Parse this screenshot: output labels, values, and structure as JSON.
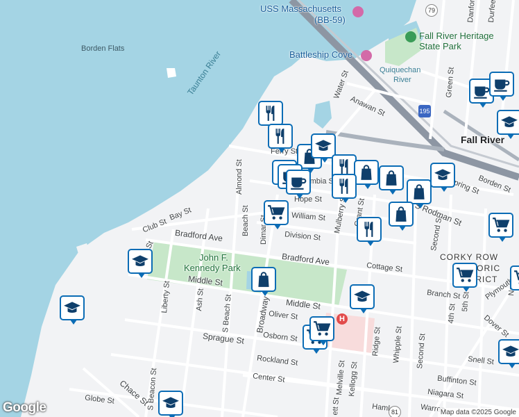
{
  "map": {
    "labels": {
      "uss_massachusetts": "USS Massachusetts",
      "bb59": "(BB-59)",
      "fall_river_heritage": "Fall River Heritage",
      "state_park": "State Park",
      "battleship_cove": "Battleship Cove",
      "quiquechan": "Quiquechan",
      "river": "River",
      "borden_flats": "Borden Flats",
      "taunton_river": "Taunton River",
      "fall_river": "Fall River",
      "jfk_park_1": "John F.",
      "jfk_park_2": "Kennedy Park",
      "corky_row_1": "CORKY ROW",
      "corky_row_2": "HISTORIC",
      "corky_row_3": "DISTRICT"
    },
    "streets": {
      "water_st": "Water St",
      "anawan_st": "Anawan St",
      "almond_st": "Almond St",
      "ferry_st": "Ferry St",
      "columbia_st": "Columbia St",
      "hope_st": "Hope St",
      "william_st": "William St",
      "bay_st": "Bay St",
      "club_st": "Club St",
      "beach_st": "Beach St",
      "dimar_st": "Dimar St",
      "mulberry_st": "Mulberry St",
      "grant_st": "Grant St",
      "division_st": "Division St",
      "bradford_ave": "Bradford Ave",
      "bradford_ave_2": "Bradford Ave",
      "bay_st_2": "Bay St",
      "liberty_st": "Liberty St",
      "ash_st": "Ash St",
      "s_beach_st": "S Beach St",
      "broadway": "Broadway",
      "middle_st": "Middle St",
      "middle_st_2": "Middle St",
      "oliver_st": "Oliver St",
      "osborn_st": "Osborn St",
      "sprague_st": "Sprague St",
      "rockland_st": "Rockland St",
      "center_st": "Center St",
      "s_beacon_st": "S Beacon St",
      "chace_st": "Chace St",
      "globe_st": "Globe St",
      "melville_st": "Melville St",
      "kellogg_st": "Kellogg St",
      "ridge_st": "Ridge St",
      "whipple_st": "Whipple St",
      "second_st": "Second St",
      "second_st_2": "Second St",
      "cottage_st": "Cottage St",
      "branch_st": "Branch St",
      "fourth_st": "4th St",
      "fifth_st": "5th St",
      "s_rodman_st": "S Rodman St",
      "spring_st": "Spring St",
      "borden_st": "Borden St",
      "green_st": "Green St",
      "durfee_st": "Durfee",
      "danforth_st": "Danforth",
      "plymouth_ave": "Plymouth",
      "dover_st": "Dover St",
      "snell_st": "Snell St",
      "buffinton_st": "Buffinton St",
      "niagara_st": "Niagara St",
      "warren_st": "Warren",
      "hamlet_st": "Hamlet",
      "ett_st": "ett St",
      "nash_st": "Nash"
    },
    "routes": {
      "i195": "195",
      "r79": "79",
      "r81": "81"
    },
    "hospital_symbol": "H",
    "pins": [
      {
        "type": "restaurant"
      },
      {
        "type": "restaurant"
      },
      {
        "type": "shopping"
      },
      {
        "type": "school"
      },
      {
        "type": "restaurant"
      },
      {
        "type": "cafe"
      },
      {
        "type": "restaurant"
      },
      {
        "type": "shopping"
      },
      {
        "type": "shopping"
      },
      {
        "type": "school"
      },
      {
        "type": "shopping"
      },
      {
        "type": "cart"
      },
      {
        "type": "restaurant"
      },
      {
        "type": "restaurant"
      },
      {
        "type": "cart"
      },
      {
        "type": "school"
      },
      {
        "type": "shopping"
      },
      {
        "type": "school"
      },
      {
        "type": "school"
      },
      {
        "type": "shopping"
      },
      {
        "type": "cart"
      },
      {
        "type": "cafe"
      },
      {
        "type": "school"
      },
      {
        "type": "cafe"
      },
      {
        "type": "cafe"
      },
      {
        "type": "school"
      },
      {
        "type": "cart"
      },
      {
        "type": "cart"
      },
      {
        "type": "school"
      },
      {
        "type": "cart"
      }
    ]
  },
  "footer": {
    "logo": "Google",
    "attribution": "Map data ©2025 Google"
  },
  "colors": {
    "water": "#a4d4e4",
    "land": "#f2f3f5",
    "park": "#c7e7c9",
    "pin_border": "#0b6cb5",
    "pin_icon": "#0f3f6b",
    "highway": "#8d96a3"
  }
}
